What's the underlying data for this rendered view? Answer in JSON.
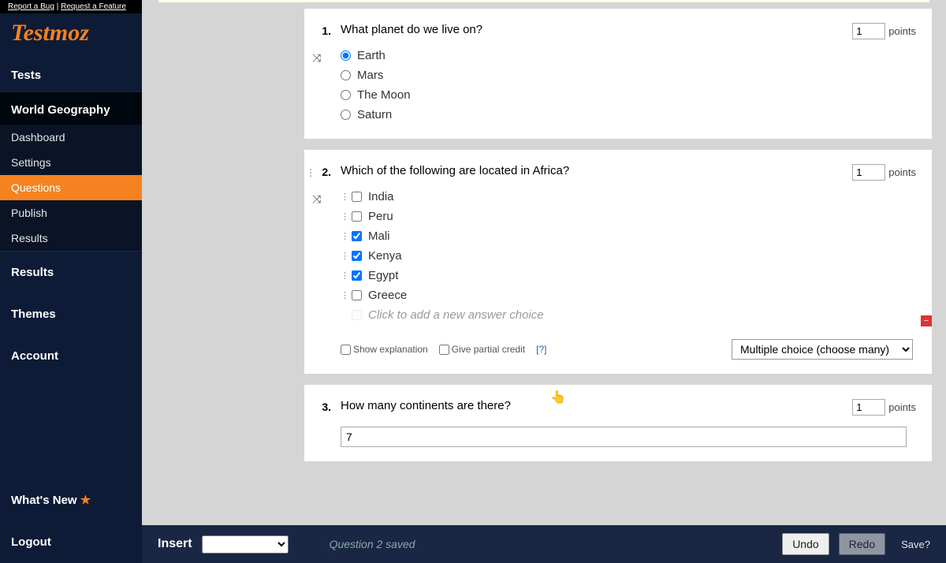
{
  "topbar": {
    "report_bug": "Report a Bug",
    "request_feature": "Request a Feature"
  },
  "logo": "Testmoz",
  "nav": {
    "tests_label": "Tests",
    "test_title": "World Geography",
    "sub": {
      "dashboard": "Dashboard",
      "settings": "Settings",
      "questions": "Questions",
      "publish": "Publish",
      "results_sub": "Results"
    },
    "results": "Results",
    "themes": "Themes",
    "account": "Account",
    "whats_new": "What's New",
    "logout": "Logout"
  },
  "questions": [
    {
      "num": "1.",
      "text": "What planet do we live on?",
      "type": "radio",
      "answers": [
        "Earth",
        "Mars",
        "The Moon",
        "Saturn"
      ],
      "selected": 0,
      "points": "1",
      "points_label": "points"
    },
    {
      "num": "2.",
      "text": "Which of the following are located in Africa?",
      "type": "checkbox",
      "answers": [
        "India",
        "Peru",
        "Mali",
        "Kenya",
        "Egypt",
        "Greece"
      ],
      "checked": [
        false,
        false,
        true,
        true,
        true,
        false
      ],
      "add_placeholder": "Click to add a new answer choice",
      "points": "1",
      "points_label": "points",
      "show_explanation_label": "Show explanation",
      "partial_credit_label": "Give partial credit",
      "help": "[?]",
      "qtype_selected": "Multiple choice (choose many)"
    },
    {
      "num": "3.",
      "text": "How many continents are there?",
      "type": "fillin",
      "answer_value": "7",
      "points": "1",
      "points_label": "points"
    }
  ],
  "actionbar": {
    "insert_label": "Insert",
    "status": "Question 2 saved",
    "undo": "Undo",
    "redo": "Redo",
    "save": "Save?"
  }
}
